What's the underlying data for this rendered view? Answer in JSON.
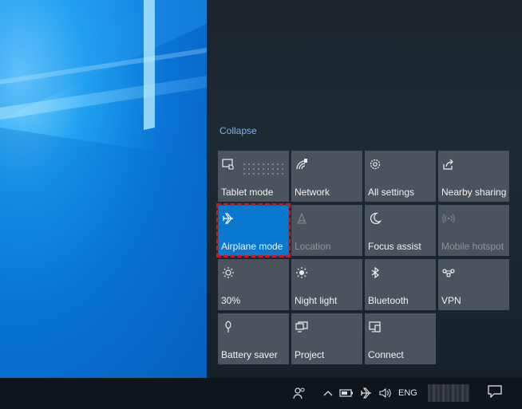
{
  "desktop": {
    "wallpaper": "windows-10-hero"
  },
  "action_center": {
    "collapse_label": "Collapse",
    "tiles": [
      {
        "label": "Tablet mode",
        "icon": "tablet-mode-icon",
        "state": "off"
      },
      {
        "label": "Network",
        "icon": "network-icon",
        "state": "off"
      },
      {
        "label": "All settings",
        "icon": "gear-icon",
        "state": "off"
      },
      {
        "label": "Nearby sharing",
        "icon": "nearby-sharing-icon",
        "state": "off"
      },
      {
        "label": "Airplane mode",
        "icon": "airplane-icon",
        "state": "on"
      },
      {
        "label": "Location",
        "icon": "location-icon",
        "state": "disabled"
      },
      {
        "label": "Focus assist",
        "icon": "moon-icon",
        "state": "off"
      },
      {
        "label": "Mobile hotspot",
        "icon": "hotspot-icon",
        "state": "disabled"
      },
      {
        "label": "30%",
        "icon": "brightness-icon",
        "state": "off"
      },
      {
        "label": "Night light",
        "icon": "night-light-icon",
        "state": "off"
      },
      {
        "label": "Bluetooth",
        "icon": "bluetooth-icon",
        "state": "off"
      },
      {
        "label": "VPN",
        "icon": "vpn-icon",
        "state": "off"
      },
      {
        "label": "Battery saver",
        "icon": "battery-saver-icon",
        "state": "off"
      },
      {
        "label": "Project",
        "icon": "project-icon",
        "state": "off"
      },
      {
        "label": "Connect",
        "icon": "connect-icon",
        "state": "off"
      }
    ]
  },
  "taskbar": {
    "tray_icons": [
      "people-icon",
      "chevron-up-icon",
      "battery-icon",
      "airplane-icon",
      "volume-icon"
    ],
    "language": "ENG",
    "notification_icon": "notification-icon"
  },
  "colors": {
    "accent": "#0b78d0",
    "highlight_border": "#d3161b",
    "tile_bg": "#4b545c",
    "link": "#7fb2e6"
  }
}
